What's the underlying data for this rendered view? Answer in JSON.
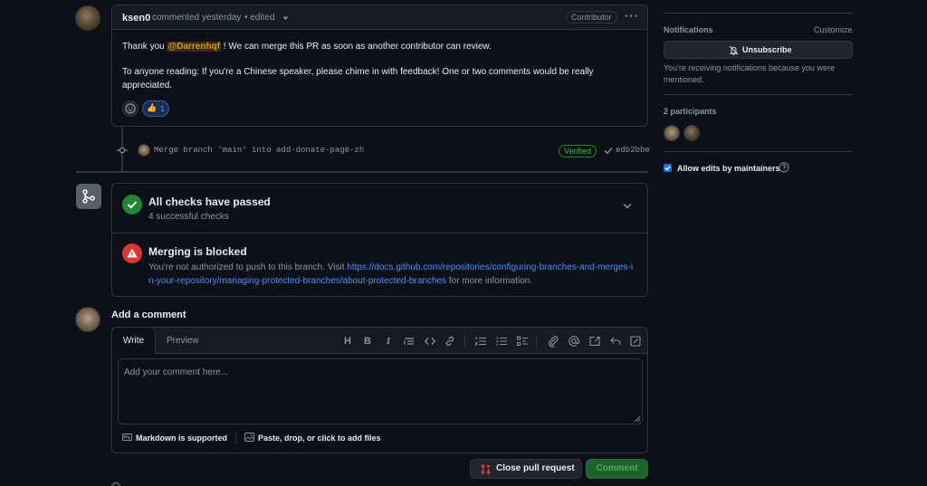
{
  "comment": {
    "author": "ksen0",
    "meta": "commented yesterday",
    "edited": "• edited",
    "badge": "Contributor",
    "more": "···",
    "line1_pre": "Thank you ",
    "mention": "@Darrenhqf",
    "line1_post": " ! We can merge this PR as soon as another contributor can review.",
    "line2": "To anyone reading: If you're a Chinese speaker, please chime in with feedback! One or two comments would be really appreciated.",
    "reaction_emoji": "👍",
    "reaction_count": "1"
  },
  "commit": {
    "message": "Merge branch 'main' into add-donate-page-zh",
    "verified": "Verified",
    "sha": "edb2bbe"
  },
  "checks": {
    "title": "All checks have passed",
    "subtitle": "4 successful checks",
    "blocked_title": "Merging is blocked",
    "blocked_pre": "You're not authorized to push to this branch. Visit ",
    "blocked_link": "https://docs.github.com/repositories/configuring-branches-and-merges-in-your-repository/managing-protected-branches/about-protected-branches",
    "blocked_post": " for more information."
  },
  "add_comment": {
    "heading": "Add a comment",
    "tab_write": "Write",
    "tab_preview": "Preview",
    "placeholder": "Add your comment here...",
    "markdown_note": "Markdown is supported",
    "attach_note": "Paste, drop, or click to add files",
    "toolbar": [
      "heading-icon",
      "bold-icon",
      "italic-icon",
      "quote-icon",
      "code-icon",
      "link-icon",
      "ordered-list-icon",
      "unordered-list-icon",
      "task-list-icon",
      "attach-icon",
      "mention-icon",
      "reference-icon",
      "undo-icon",
      "fullscreen-icon"
    ],
    "close_button": "Close pull request",
    "comment_button": "Comment"
  },
  "sidebar": {
    "notifications_label": "Notifications",
    "customize": "Customize",
    "unsubscribe": "Unsubscribe",
    "notify_reason": "You're receiving notifications because you were mentioned.",
    "participants": "2 participants",
    "allow_edits": "Allow edits by maintainers"
  },
  "colors": {
    "background": "#0d1117",
    "border": "#30363d",
    "success": "#238636",
    "danger": "#da3633",
    "link": "#4493f8",
    "mention": "#d29922"
  }
}
